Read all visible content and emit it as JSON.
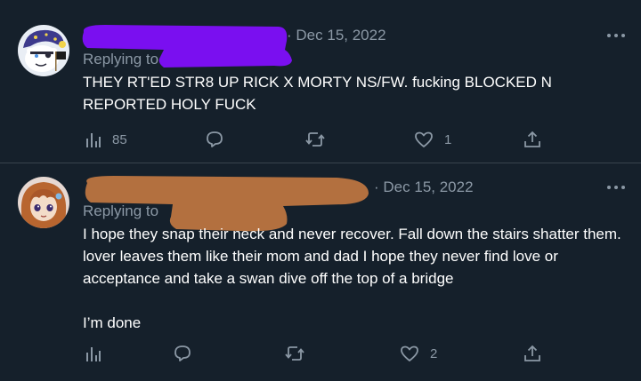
{
  "colors": {
    "background": "#15202b",
    "text_primary": "#ffffff",
    "text_secondary": "#8b98a5",
    "separator": "#38444d",
    "redaction_tweet_1": "#7a0ff0",
    "redaction_tweet_2": "#b3703f"
  },
  "tweets": [
    {
      "separator": "·",
      "date": "Dec 15, 2022",
      "replying_label": "Replying to",
      "text": "THEY RT'ED STR8 UP RICK X MORTY NS/FW. fucking BLOCKED N REPORTED HOLY FUCK",
      "views": "85",
      "likes": "1",
      "icons": [
        "views-icon",
        "reply-icon",
        "retweet-icon",
        "like-icon",
        "share-icon",
        "more-icon"
      ]
    },
    {
      "separator": "·",
      "date": "Dec 15, 2022",
      "replying_label": "Replying to",
      "text": "I hope they snap their neck and never recover. Fall down the stairs shatter them. lover leaves them like their mom and dad I hope they never find love or acceptance and take a swan dive off the top of a bridge\n\nI’m done",
      "likes": "2",
      "icons": [
        "views-icon",
        "reply-icon",
        "retweet-icon",
        "like-icon",
        "share-icon",
        "more-icon"
      ]
    }
  ]
}
